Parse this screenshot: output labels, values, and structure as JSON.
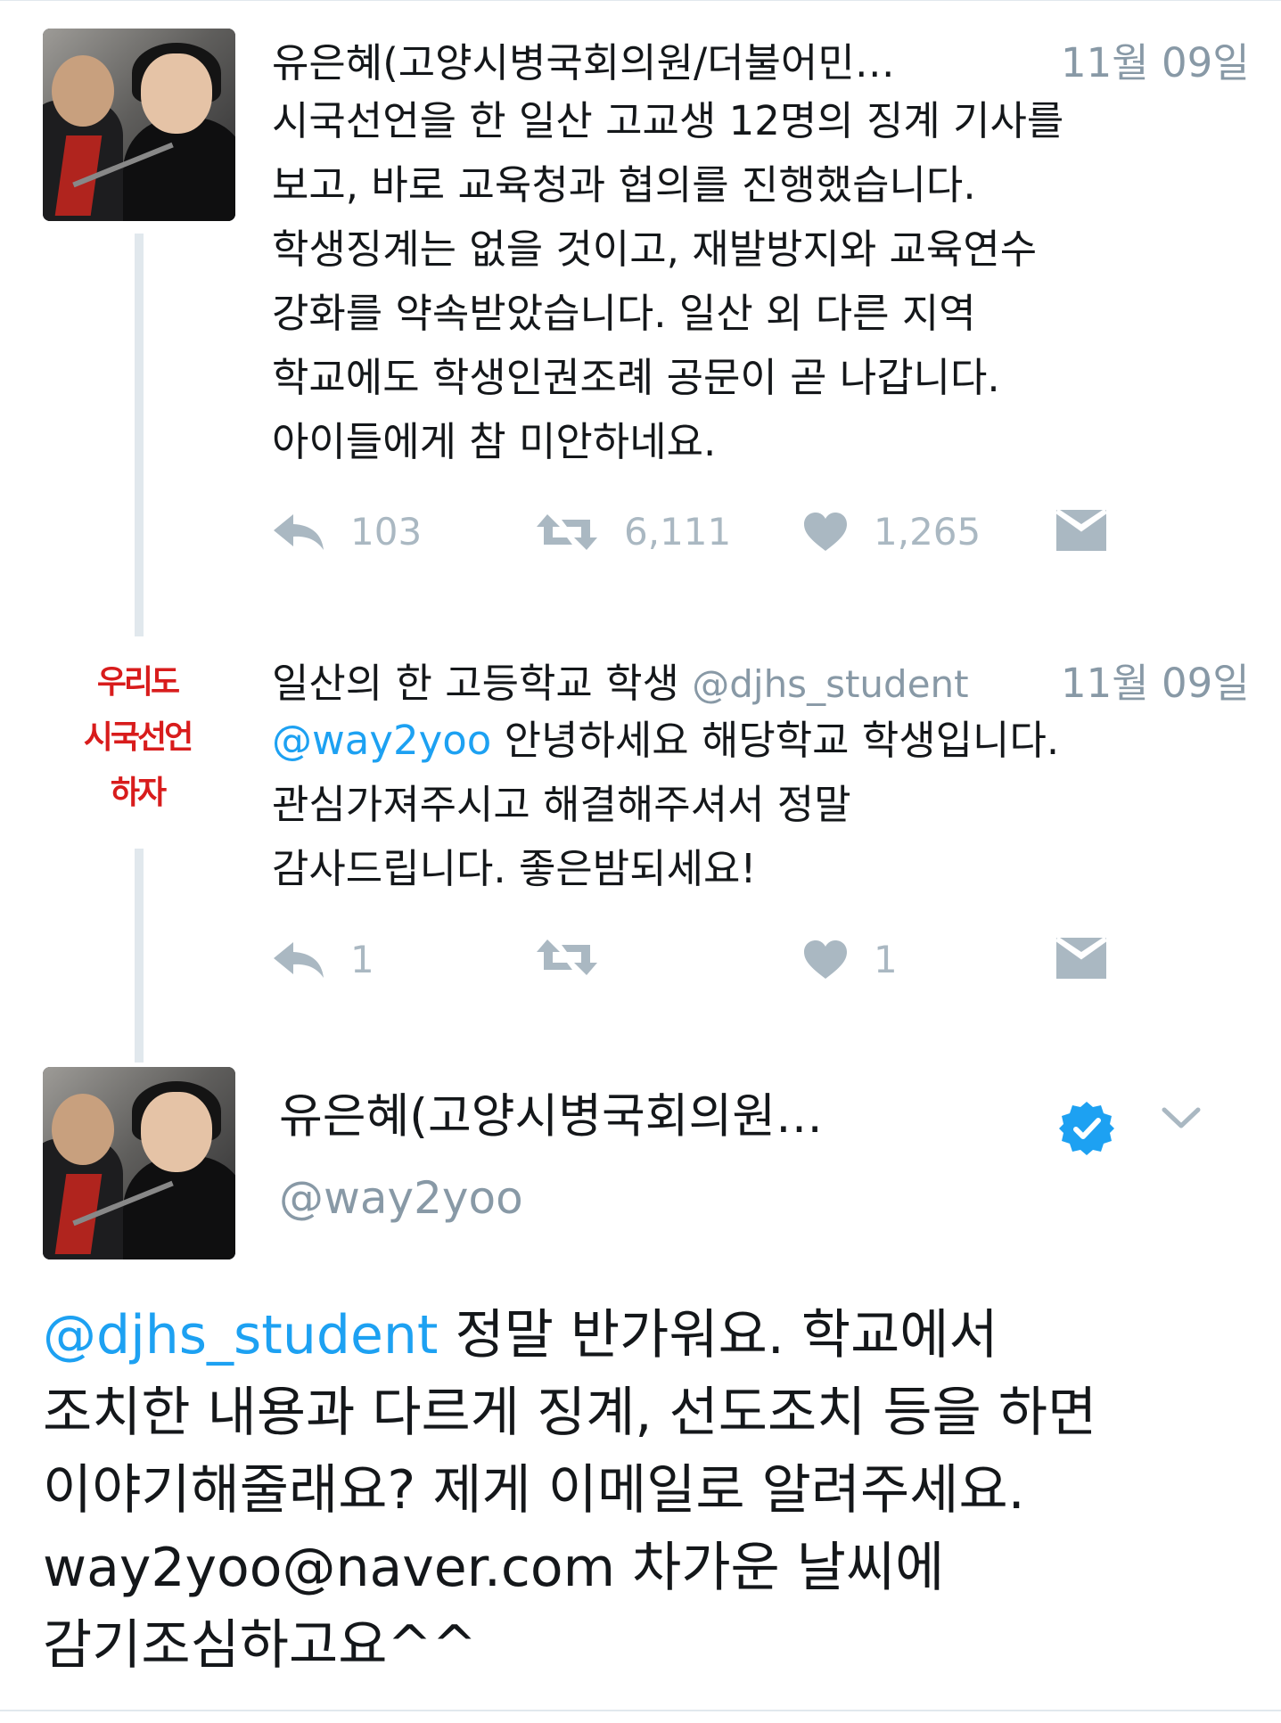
{
  "tweets": [
    {
      "name": "유은혜(고양시병국회의원/더불어민…",
      "time": "11월 09일",
      "lines": [
        "시국선언을 한 일산 고교생 12명의 징계 기사를",
        "보고, 바로 교육청과 협의를 진행했습니다.",
        "학생징계는 없을 것이고, 재발방지와 교육연수",
        "강화를 약속받았습니다. 일산 외 다른 지역",
        "학교에도 학생인권조례 공문이 곧 나갑니다.",
        "아이들에게 참 미안하네요."
      ],
      "reply_count": "103",
      "retweet_count": "6,111",
      "like_count": "1,265"
    },
    {
      "name": "일산의 한 고등학교 학생",
      "handle": "@djhs_student",
      "time": "11월 09일",
      "mention": "@way2yoo",
      "line1_rest": " 안녕하세요 해당학교 학생입니다.",
      "lines": [
        "관심가져주시고 해결해주셔서 정말",
        "감사드립니다. 좋은밤되세요!"
      ],
      "reply_count": "1",
      "retweet_count": "",
      "like_count": "1",
      "avatar_text": [
        "우리도",
        "시국선언",
        "하자"
      ]
    }
  ],
  "main_tweet": {
    "name": "유은혜(고양시병국회의원…",
    "handle": "@way2yoo",
    "mention": "@djhs_student",
    "line1_rest": " 정말 반가워요. 학교에서",
    "lines": [
      "조치한 내용과 다르게 징계, 선도조치 등을 하면",
      "이야기해줄래요? 제게 이메일로 알려주세요.",
      "way2yoo@naver.com 차가운 날씨에",
      "감기조심하고요^^"
    ]
  },
  "colors": {
    "link": "#1da1f2",
    "muted": "#8899a6",
    "icon": "#aab8c2",
    "sticker_red": "#d81c1c"
  },
  "icons": [
    "reply-icon",
    "retweet-icon",
    "like-icon",
    "dm-icon",
    "verified-badge-icon",
    "chevron-down-icon"
  ]
}
